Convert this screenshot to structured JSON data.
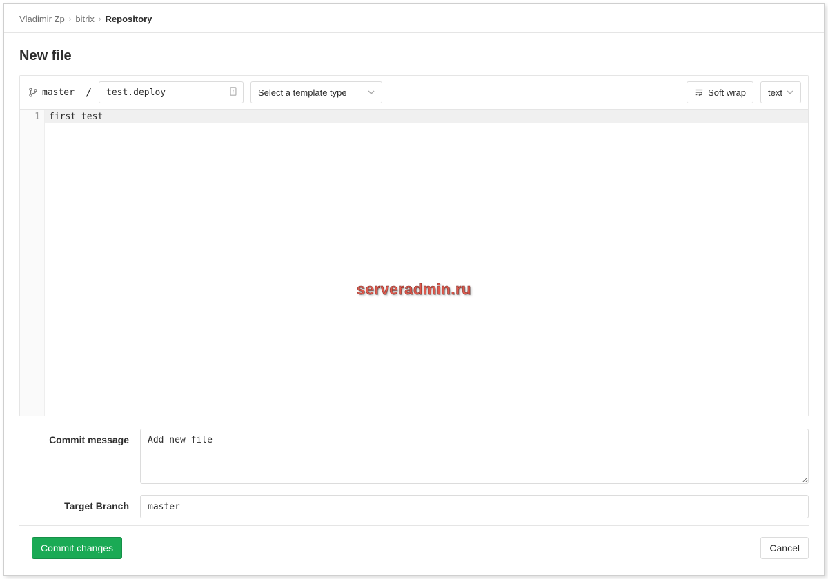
{
  "breadcrumb": {
    "owner": "Vladimir Zp",
    "project": "bitrix",
    "page": "Repository"
  },
  "page_title": "New file",
  "toolbar": {
    "branch": "master",
    "separator": "/",
    "filename": "test.deploy",
    "template_label": "Select a template type",
    "softwrap_label": "Soft wrap",
    "syntax_label": "text"
  },
  "editor": {
    "line_number": "1",
    "content": "first test"
  },
  "form": {
    "commit_message_label": "Commit message",
    "commit_message_value": "Add new file",
    "target_branch_label": "Target Branch",
    "target_branch_value": "master"
  },
  "actions": {
    "commit": "Commit changes",
    "cancel": "Cancel"
  },
  "watermark": "serveradmin.ru"
}
